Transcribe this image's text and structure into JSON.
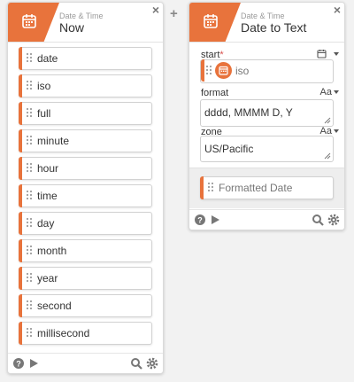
{
  "card_now": {
    "subtitle": "Date & Time",
    "title": "Now",
    "outputs": [
      "date",
      "iso",
      "full",
      "minute",
      "hour",
      "time",
      "day",
      "month",
      "year",
      "second",
      "millisecond"
    ]
  },
  "card_dtt": {
    "subtitle": "Date & Time",
    "title": "Date to Text",
    "start": {
      "label": "start",
      "required_mark": "*",
      "pill_label": "iso"
    },
    "format": {
      "label": "format",
      "type_toggle": "Aa",
      "value": "dddd, MMMM D, Y"
    },
    "zone": {
      "label": "zone",
      "type_toggle": "Aa",
      "value": "US/Pacific"
    },
    "output_label": "Formatted Date"
  },
  "icons": {
    "tag_icon": "calendar-icon",
    "close": "close-icon",
    "grip": "drag-handle-icon",
    "help": "help-icon",
    "play": "play-icon",
    "search": "search-icon",
    "settings": "gear-icon",
    "add": "plus-icon",
    "resize": "resize-handle-icon"
  },
  "colors": {
    "accent": "#e8733c",
    "required": "#d9534f"
  }
}
